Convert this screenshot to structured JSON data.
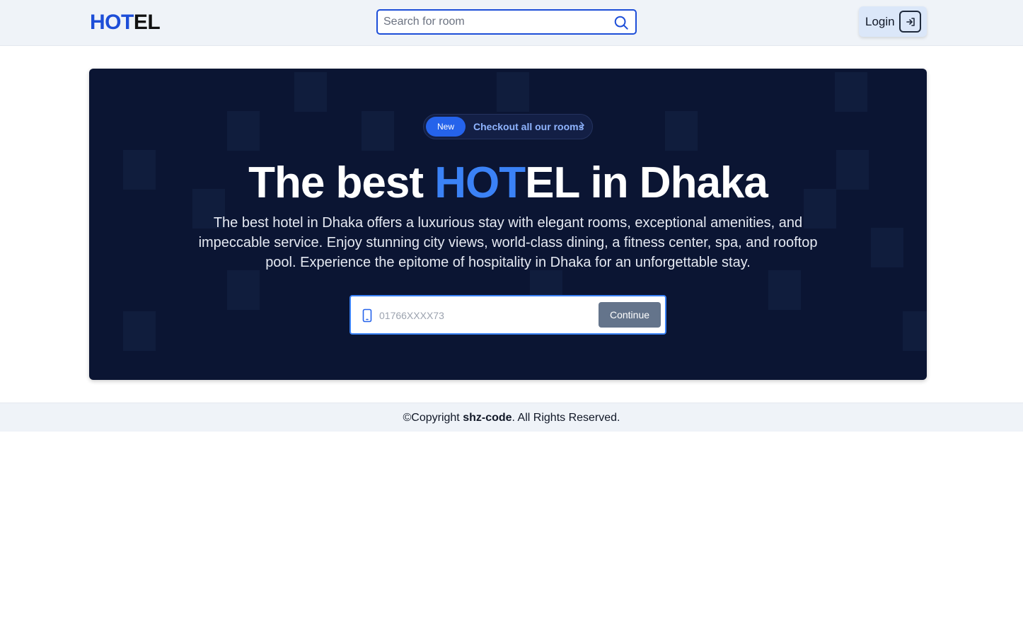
{
  "header": {
    "logo_part1": "HOT",
    "logo_part2": "EL",
    "search": {
      "placeholder": "Search for room"
    },
    "login_label": "Login"
  },
  "hero": {
    "badge": {
      "tag": "New",
      "link_text": "Checkout all our rooms"
    },
    "headline": {
      "part1": "The best ",
      "highlight": "HOT",
      "part2": "EL in Dhaka"
    },
    "description": "The best hotel in Dhaka offers a luxurious stay with elegant rooms, exceptional amenities, and impeccable service. Enjoy stunning city views, world-class dining, a fitness center, spa, and rooftop pool. Experience the epitome of hospitality in Dhaka for an unforgettable stay.",
    "phone_input": {
      "placeholder": "01766XXXX73"
    },
    "continue_label": "Continue"
  },
  "footer": {
    "copyright_prefix": "©Copyright ",
    "brand": "shz-code",
    "suffix": ". All Rights Reserved."
  },
  "colors": {
    "brand_blue": "#1d4ed8",
    "accent_blue": "#3b82f6",
    "hero_bg": "#0b1533",
    "continue_bg": "#64748b",
    "header_bg": "#eff3f8"
  },
  "icons": {
    "search": "search-icon",
    "login": "login-arrow-icon",
    "chevron": "chevron-right-icon",
    "phone": "phone-icon"
  }
}
